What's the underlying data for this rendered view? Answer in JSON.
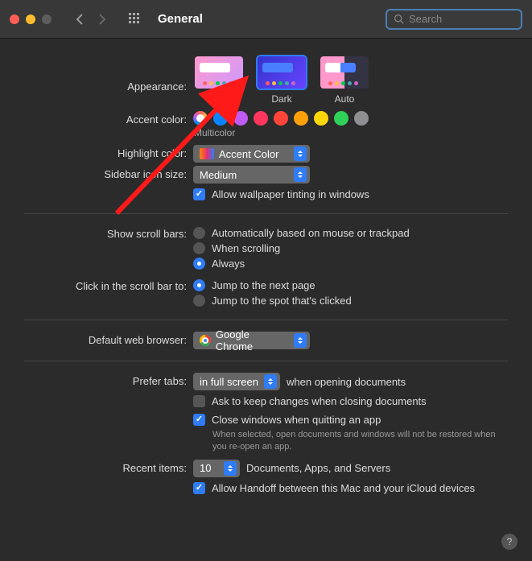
{
  "window": {
    "title": "General"
  },
  "search": {
    "placeholder": "Search"
  },
  "labels": {
    "appearance": "Appearance:",
    "accent": "Accent color:",
    "highlight": "Highlight color:",
    "sidebar_size": "Sidebar icon size:",
    "scroll_bars": "Show scroll bars:",
    "click_scroll": "Click in the scroll bar to:",
    "default_browser": "Default web browser:",
    "prefer_tabs": "Prefer tabs:",
    "recent_items": "Recent items:"
  },
  "appearance": {
    "options": [
      {
        "label": "Light",
        "selected": false
      },
      {
        "label": "Dark",
        "selected": true
      },
      {
        "label": "Auto",
        "selected": false
      }
    ]
  },
  "accent": {
    "caption": "Multicolor",
    "colors": [
      "multicolor",
      "#0a84ff",
      "#bf5af2",
      "#ff375f",
      "#ff453a",
      "#ff9f0a",
      "#ffd60a",
      "#30d158",
      "#8e8e93"
    ],
    "selected_index": 0
  },
  "highlight": {
    "value": "Accent Color"
  },
  "sidebar_size": {
    "value": "Medium"
  },
  "wallpaper_tint": {
    "label": "Allow wallpaper tinting in windows",
    "checked": true
  },
  "scroll_bars": {
    "options": [
      {
        "label": "Automatically based on mouse or trackpad",
        "checked": false
      },
      {
        "label": "When scrolling",
        "checked": false
      },
      {
        "label": "Always",
        "checked": true
      }
    ]
  },
  "click_scroll": {
    "options": [
      {
        "label": "Jump to the next page",
        "checked": true
      },
      {
        "label": "Jump to the spot that's clicked",
        "checked": false
      }
    ]
  },
  "default_browser": {
    "value": "Google Chrome"
  },
  "prefer_tabs": {
    "value": "in full screen",
    "suffix": "when opening documents"
  },
  "ask_keep_changes": {
    "label": "Ask to keep changes when closing documents",
    "checked": false
  },
  "close_windows": {
    "label": "Close windows when quitting an app",
    "checked": true,
    "hint": "When selected, open documents and windows will not be restored when you re-open an app."
  },
  "recent_items": {
    "value": "10",
    "suffix": "Documents, Apps, and Servers"
  },
  "handoff": {
    "label": "Allow Handoff between this Mac and your iCloud devices",
    "checked": true
  }
}
